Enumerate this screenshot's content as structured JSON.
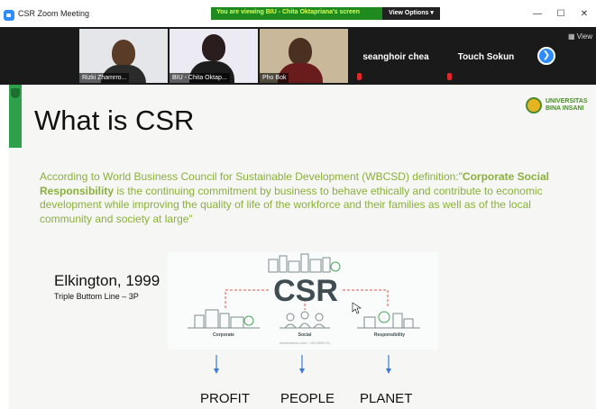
{
  "window": {
    "title": "CSR  Zoom Meeting",
    "viewing_banner": "You are viewing BIU - Chita Oktapriana's screen",
    "view_options_label": "View Options ▾",
    "minimize_label": "—",
    "maximize_label": "☐",
    "close_label": "✕"
  },
  "participants": {
    "tiles": [
      {
        "name": "Rizki Zhamrro..."
      },
      {
        "name": "BIU - Chita Oktap..."
      },
      {
        "name": "Pho Bok"
      }
    ],
    "name_only": [
      {
        "name": "seanghoir chea"
      },
      {
        "name": "Touch Sokun"
      }
    ],
    "next_label": "❯",
    "view_label": "▦ View"
  },
  "slide": {
    "title": "What is CSR",
    "logo_text_line1": "UNIVERSITAS",
    "logo_text_line2": "BINA INSANI",
    "definition_prefix": "According to World Business Council for Sustainable Development (WBCSD) definition:\"",
    "definition_bold": "Corporate Social Responsibility",
    "definition_rest": " is the continuing commitment by business to behave ethically and contribute to economic development while improving the quality of life of the workforce and their families as well as of the local community and society at large\"",
    "elkington_title": "Elkington, 1999",
    "elkington_sub": "Triple Buttom Line – 3P",
    "graphic": {
      "center_text": "CSR",
      "labels": [
        "Corporate",
        "Social",
        "Responsibility"
      ],
      "credit": "shutterstock.com • 1512839741"
    },
    "outcomes": [
      "PROFIT",
      "PEOPLE",
      "PLANET"
    ]
  },
  "colors": {
    "zoom_blue": "#2d8cff",
    "banner_green": "#1f8a1f",
    "banner_text": "#d8ff52",
    "slide_accent": "#2ea04a",
    "definition_text": "#8ab13a",
    "arrow_blue": "#3a7bd5"
  }
}
